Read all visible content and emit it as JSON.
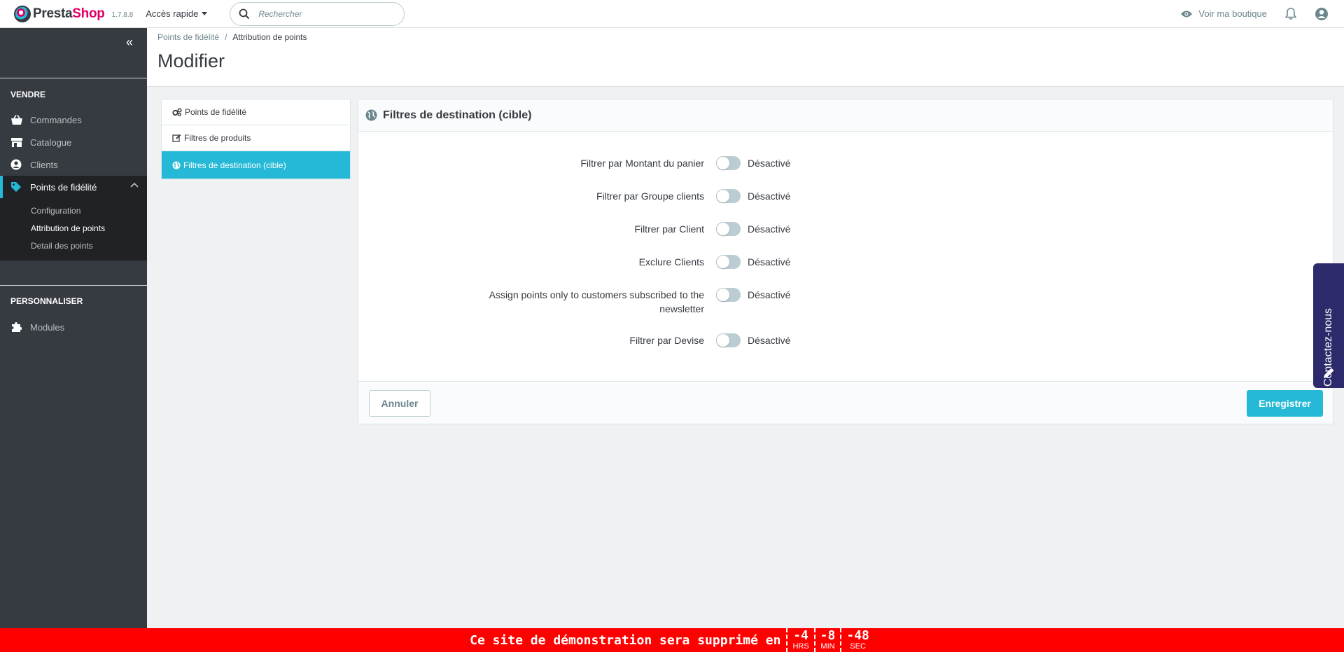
{
  "header": {
    "logo_presta": "Presta",
    "logo_shop": "Shop",
    "version": "1.7.8.8",
    "quick_access": "Accès rapide",
    "search_placeholder": "Rechercher",
    "view_shop": "Voir ma boutique"
  },
  "sidebar": {
    "section_sell": "VENDRE",
    "items": [
      {
        "label": "Commandes",
        "icon": "basket-icon"
      },
      {
        "label": "Catalogue",
        "icon": "store-icon"
      },
      {
        "label": "Clients",
        "icon": "user-circle-icon"
      },
      {
        "label": "Points de fidélité",
        "icon": "tag-icon"
      }
    ],
    "sub_items": [
      "Configuration",
      "Attribution de points",
      "Detail des points"
    ],
    "section_customize": "PERSONNALISER",
    "modules": "Modules"
  },
  "breadcrumb": {
    "parent": "Points de fidélité",
    "separator": "/",
    "current": "Attribution de points"
  },
  "page_title": "Modifier",
  "tabs": [
    {
      "label": "Points de fidélité",
      "icon": "cogs-icon"
    },
    {
      "label": "Filtres de produits",
      "icon": "edit-icon"
    },
    {
      "label": "Filtres de destination (cible)",
      "icon": "globe-icon"
    }
  ],
  "panel": {
    "title": "Filtres de destination (cible)",
    "rows": [
      {
        "label": "Filtrer par Montant du panier",
        "state": "Désactivé"
      },
      {
        "label": "Filtrer par Groupe clients",
        "state": "Désactivé"
      },
      {
        "label": "Filtrer par Client",
        "state": "Désactivé"
      },
      {
        "label": "Exclure Clients",
        "state": "Désactivé"
      },
      {
        "label": "Assign points only to customers subscribed to the newsletter",
        "state": "Désactivé"
      },
      {
        "label": "Filtrer par Devise",
        "state": "Désactivé"
      }
    ],
    "cancel": "Annuler",
    "save": "Enregistrer"
  },
  "contact": "Contactez-nous",
  "banner": {
    "message": "Ce site de démonstration sera supprimé en",
    "hours": "-4",
    "hours_unit": "HRS",
    "minutes": "-8",
    "minutes_unit": "MIN",
    "seconds": "-48",
    "seconds_unit": "SEC"
  },
  "colors": {
    "accent": "#25b9d7",
    "sidebar": "#363a41",
    "brand_pink": "#df0067",
    "banner": "#ff0000",
    "contact": "#2c2a6b"
  }
}
